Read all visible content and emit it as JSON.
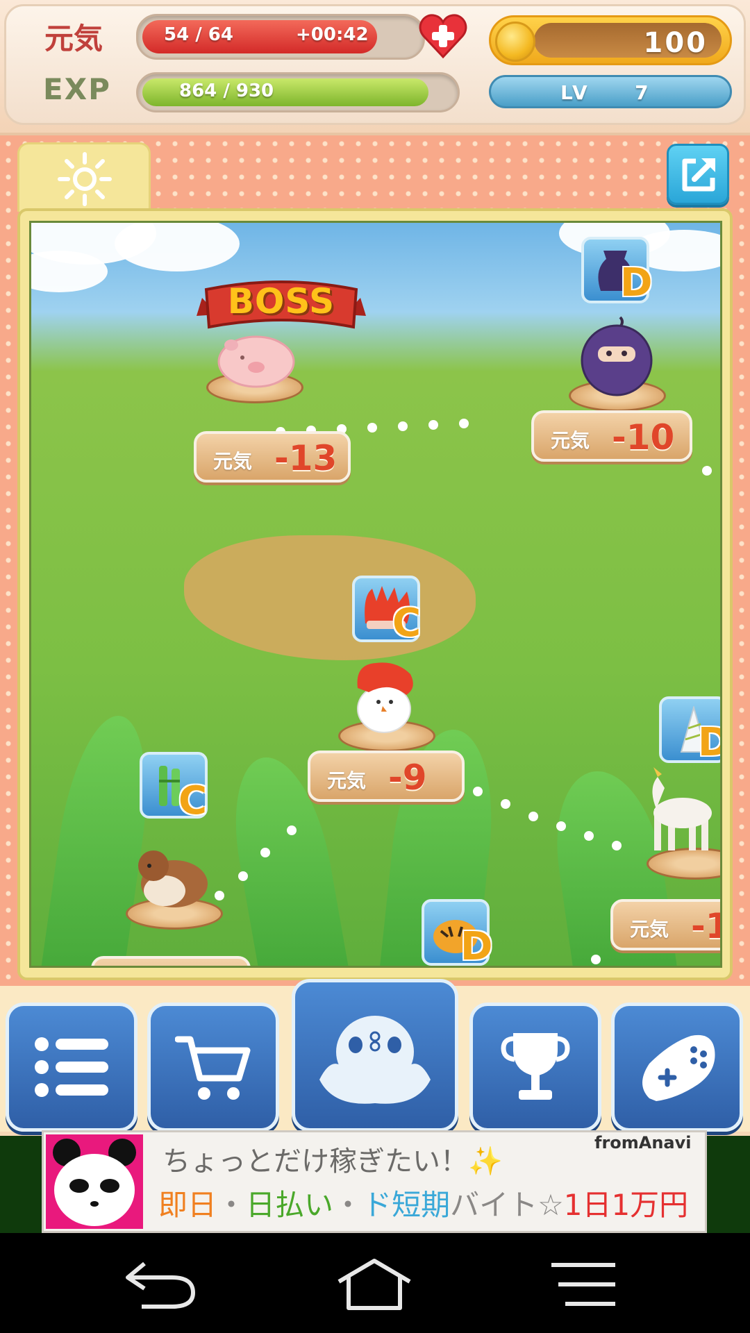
{
  "status": {
    "genki_label": "元気",
    "genki_value": "54 /  64",
    "genki_fraction": 0.84,
    "genki_timer": "+00:42",
    "exp_label": "EXP",
    "exp_value": "864 /    930",
    "exp_fraction": 0.93,
    "coins": "100",
    "level_label": "LV",
    "level_value": "7",
    "heart_icon": "heart-plus-icon",
    "coin_icon": "coin-icon"
  },
  "board": {
    "weather_icon": "sun-icon",
    "share_icon": "share-icon",
    "boss_label": "BOSS"
  },
  "stages": [
    {
      "creature": "pig",
      "cost_label": "元気",
      "cost_value": "-13",
      "boss": true
    },
    {
      "creature": "purple-bomb-ninja",
      "cost_label": "元気",
      "cost_value": "-10",
      "item": "purple-pot",
      "grade": "D"
    },
    {
      "creature": "red-haired-chicken",
      "cost_label": "元気",
      "cost_value": "-9",
      "item": "red-hair-hat",
      "grade": "C"
    },
    {
      "creature": "sparrow",
      "item": "bamboo",
      "grade": "C"
    },
    {
      "creature": "unicorn",
      "cost_label": "元気",
      "cost_value": "-1",
      "item": "unicorn-horn",
      "grade": "D"
    },
    {
      "creature": "none",
      "item": "tiger-hat",
      "grade": "D"
    }
  ],
  "nav": {
    "items": [
      {
        "name": "menu-list-icon"
      },
      {
        "name": "shop-cart-icon"
      },
      {
        "name": "home-creature-icon"
      },
      {
        "name": "trophy-icon"
      },
      {
        "name": "gamepad-icon"
      }
    ]
  },
  "ad": {
    "line1": "ちょっとだけ稼ぎたい！✨",
    "brand": "fromAnavi",
    "line2_part1": "即日",
    "line2_sep1": "・",
    "line2_part2": "日払い",
    "line2_sep2": "・",
    "line2_part3": "ド短期",
    "line2_part4": "バイト☆",
    "line2_part5": "1日1万円"
  },
  "system_nav": [
    "back-icon",
    "home-icon",
    "recent-apps-icon"
  ],
  "colors": {
    "accent_red": "#e0462a",
    "nav_blue": "#2f5fa7",
    "coin_gold": "#f4b922",
    "level_blue": "#4a9fc8",
    "genki_red": "#e23a3a",
    "exp_green": "#8cc63a"
  }
}
